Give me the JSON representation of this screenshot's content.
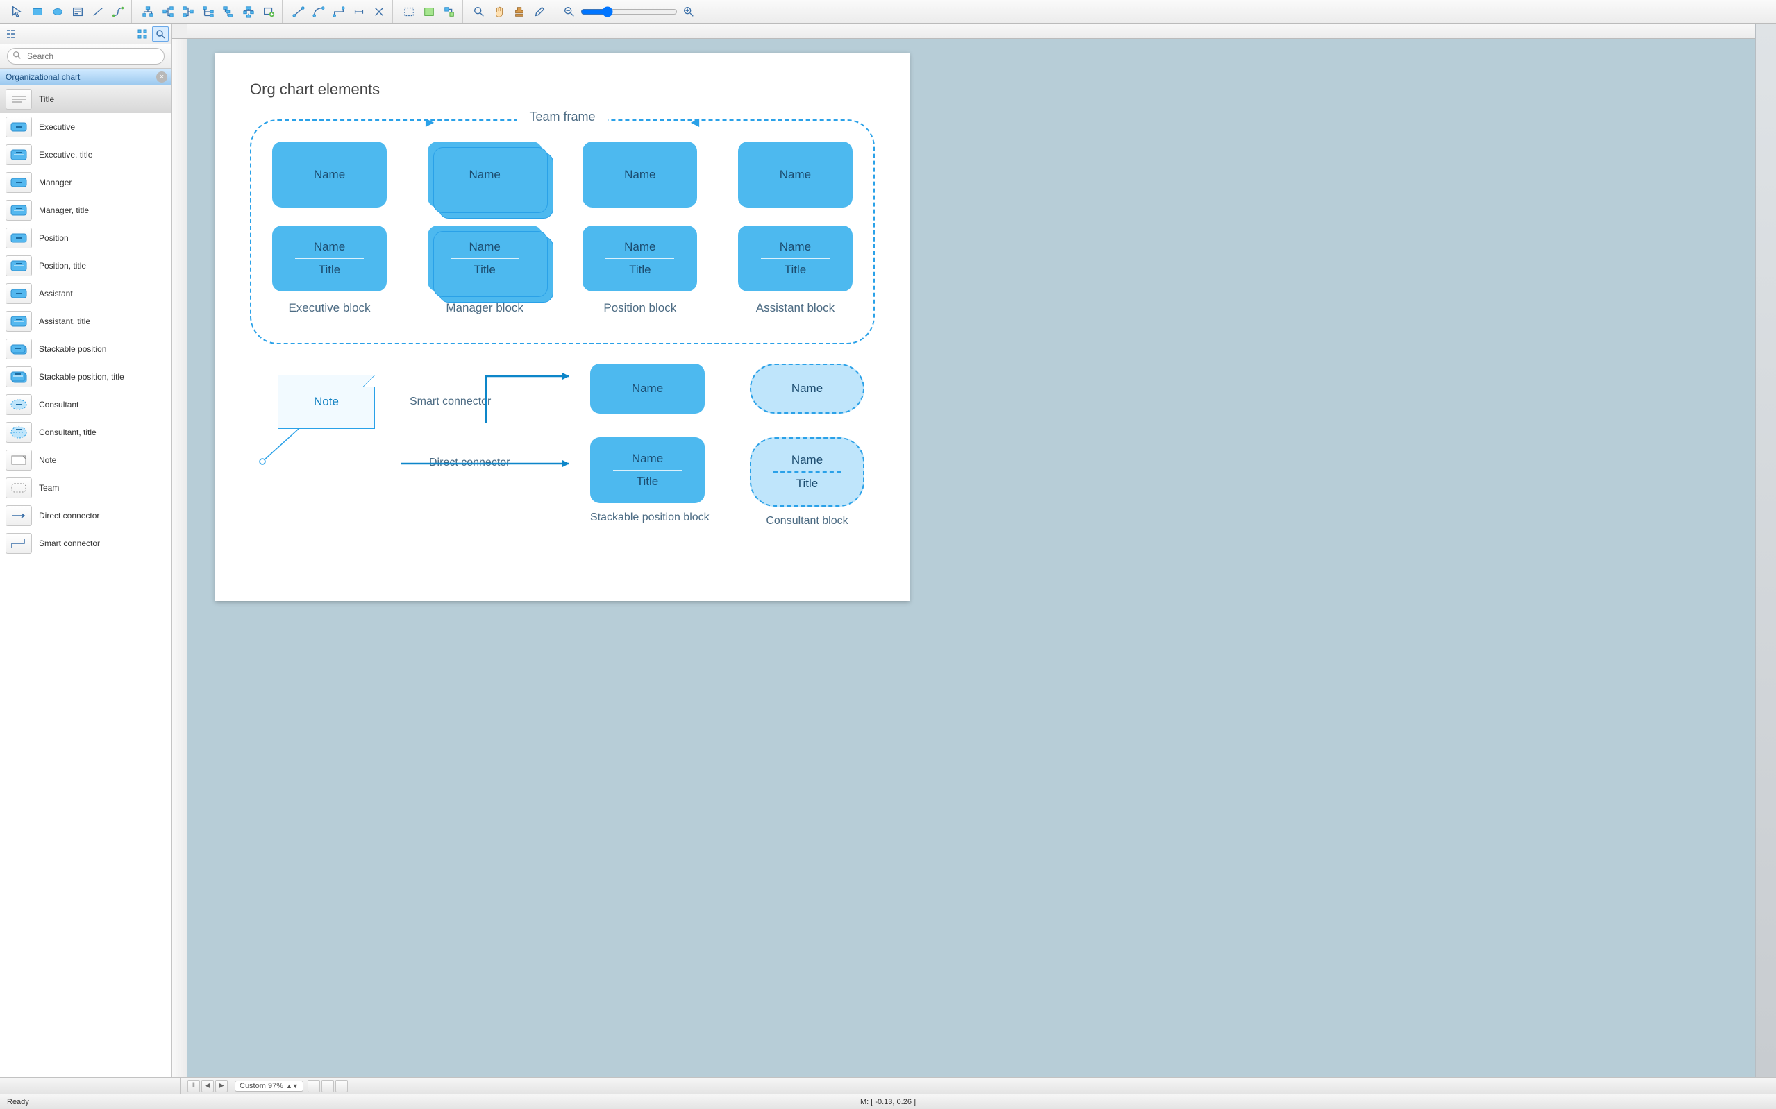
{
  "sidebar": {
    "search_placeholder": "Search",
    "library_title": "Organizational chart",
    "items": [
      {
        "label": "Title"
      },
      {
        "label": "Executive"
      },
      {
        "label": "Executive, title"
      },
      {
        "label": "Manager"
      },
      {
        "label": "Manager, title"
      },
      {
        "label": "Position"
      },
      {
        "label": "Position, title"
      },
      {
        "label": "Assistant"
      },
      {
        "label": "Assistant, title"
      },
      {
        "label": "Stackable position"
      },
      {
        "label": "Stackable position, title"
      },
      {
        "label": "Consultant"
      },
      {
        "label": "Consultant, title"
      },
      {
        "label": "Note"
      },
      {
        "label": "Team"
      },
      {
        "label": "Direct connector"
      },
      {
        "label": "Smart connector"
      }
    ]
  },
  "page": {
    "title": "Org chart elements",
    "team_frame_label": "Team frame",
    "name": "Name",
    "title_text": "Title",
    "col_labels": {
      "executive": "Executive block",
      "manager": "Manager block",
      "position": "Position block",
      "assistant": "Assistant block",
      "stackable": "Stackable position block",
      "consultant": "Consultant block"
    },
    "note_text": "Note",
    "smart_connector": "Smart connector",
    "direct_connector": "Direct connector"
  },
  "bottombar": {
    "zoom_label": "Custom 97%"
  },
  "statusbar": {
    "ready": "Ready",
    "mouse": "M: [ -0.13, 0.26 ]"
  }
}
